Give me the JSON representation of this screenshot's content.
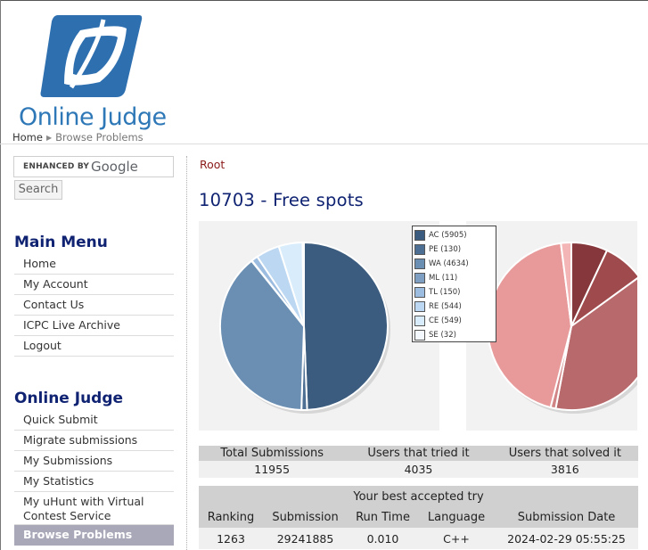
{
  "header": {
    "logo_text": "Online Judge",
    "breadcrumb": [
      "Home",
      "Browse Problems"
    ]
  },
  "sidebar": {
    "search": {
      "enhanced_label": "ENHANCED BY",
      "provider": "Google",
      "button_label": "Search"
    },
    "main_menu": {
      "title": "Main Menu",
      "items": [
        "Home",
        "My Account",
        "Contact Us",
        "ICPC Live Archive",
        "Logout"
      ]
    },
    "online_judge": {
      "title": "Online Judge",
      "items": [
        "Quick Submit",
        "Migrate submissions",
        "My Submissions",
        "My Statistics",
        "My uHunt with Virtual Contest Service",
        "Browse Problems"
      ],
      "active_index": 5
    }
  },
  "main": {
    "root_link": "Root",
    "problem_title": "10703 - Free spots",
    "stats": {
      "headers": [
        "Total Submissions",
        "Users that tried it",
        "Users that solved it"
      ],
      "values": [
        "11955",
        "4035",
        "3816"
      ]
    },
    "best_try": {
      "caption": "Your best accepted try",
      "headers": [
        "Ranking",
        "Submission",
        "Run Time",
        "Language",
        "Submission Date"
      ],
      "values": [
        "1263",
        "29241885",
        "0.010",
        "C++",
        "2024-02-29 05:55:25"
      ]
    }
  },
  "chart_data": [
    {
      "type": "pie",
      "legend_position": "right",
      "slices": [
        {
          "label": "AC (5905)",
          "value": 5905,
          "color": "#3b5c7e"
        },
        {
          "label": "PE (130)",
          "value": 130,
          "color": "#4d6f93"
        },
        {
          "label": "WA (4634)",
          "value": 4634,
          "color": "#6a8fb3"
        },
        {
          "label": "ML (11)",
          "value": 11,
          "color": "#7e9ec2"
        },
        {
          "label": "TL (150)",
          "value": 150,
          "color": "#9dbde0"
        },
        {
          "label": "RE (544)",
          "value": 544,
          "color": "#bcd7f2"
        },
        {
          "label": "CE (549)",
          "value": 549,
          "color": "#d8ecfb"
        },
        {
          "label": "SE (32)",
          "value": 32,
          "color": "#f2f8fd"
        }
      ]
    },
    {
      "type": "pie",
      "slices": [
        {
          "value": 7,
          "color": "#86373b"
        },
        {
          "value": 8,
          "color": "#9f4a4c"
        },
        {
          "value": 38,
          "color": "#b8696b"
        },
        {
          "value": 1,
          "color": "#d18486"
        },
        {
          "value": 44,
          "color": "#e89a9b"
        },
        {
          "value": 2,
          "color": "#f3b5b5"
        }
      ]
    }
  ]
}
